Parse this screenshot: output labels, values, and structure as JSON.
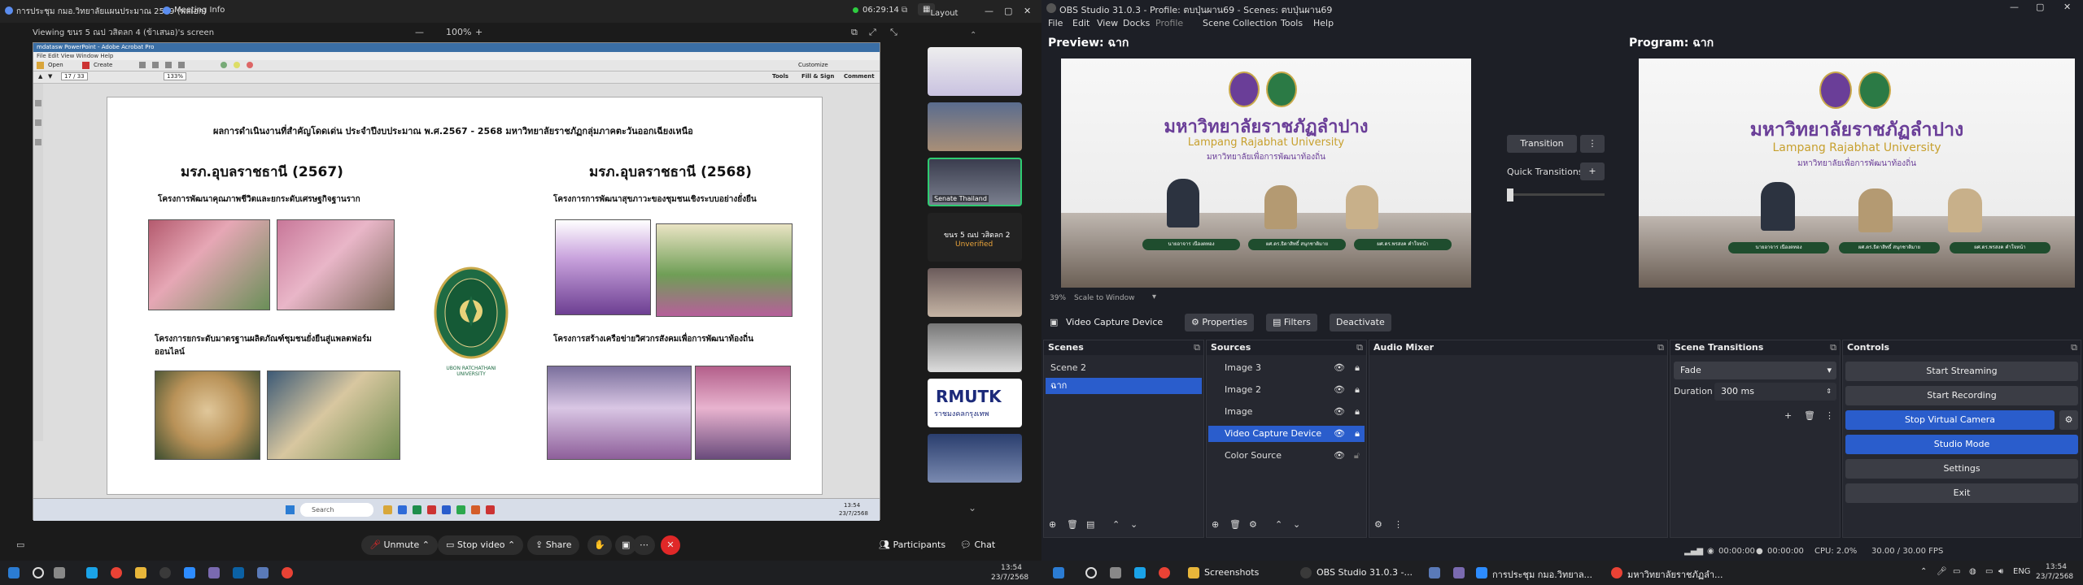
{
  "zoom": {
    "top": {
      "meeting_title": "การประชุม กมอ.วิทยาลัยแผนประมาณ 2569 (พลเอก)",
      "meeting_info": "Meeting Info",
      "timer": "06:29:14",
      "layout": "Layout"
    },
    "viewing": {
      "label": "Viewing ขนร 5 ณป วสิตลก 4 (ข้าเสนอ)'s screen",
      "zoom_level": "100%",
      "minus": "—",
      "plus": "+"
    },
    "shared_app": {
      "title": "mdatasw PowerPoint - Adobe Acrobat Pro",
      "menu": "File  Edit  View  Window  Help",
      "open": "Open",
      "create": "Create",
      "customize": "Customize",
      "page": "17 / 33",
      "zoom": "133%",
      "tools": "Tools",
      "fill_sign": "Fill & Sign",
      "comment": "Comment",
      "search": "Search",
      "clock": "13:54",
      "date": "23/7/2568"
    },
    "slide": {
      "heading": "ผลการดำเนินงานที่สำคัญโดดเด่น ประจำปีงบประมาณ พ.ศ.2567 - 2568  มหาวิทยาลัยราชภัฏกลุ่มภาคตะวันออกเฉียงเหนือ",
      "left_title": "มรภ.อุบลราชธานี (2567)",
      "right_title": "มรภ.อุบลราชธานี (2568)",
      "left_proj1": "โครงการพัฒนาคุณภาพชีวิตและยกระดับเศรษฐกิจฐานราก",
      "left_proj2": "โครงการยกระดับมาตรฐานผลิตภัณฑ์ชุมชนยั่งยืนสู่แพลตฟอร์ม",
      "left_proj2b": "ออนไลน์",
      "right_proj1": "โครงการการพัฒนาสุขภาวะของชุมชนเชิงระบบอย่างยั่งยืน",
      "right_proj2": "โครงการสร้างเครือข่ายวิศวกรสังคมเพื่อการพัฒนาท้องถิ่น",
      "logo_text": "UBON RATCHATHANI UNIVERSITY"
    },
    "participants": [
      {
        "name": ""
      },
      {
        "name": ""
      },
      {
        "name": "Senate Thailand"
      },
      {
        "name": "ขนร 5 ณป วสิตลก 2",
        "status": "Unverified"
      },
      {
        "name": ""
      },
      {
        "name": ""
      },
      {
        "name": "RMUTK",
        "sub": "ราชมงคลกรุงเทพ"
      },
      {
        "name": ""
      }
    ],
    "controls": {
      "unmute": "Unmute",
      "stop_video": "Stop video",
      "share": "Share",
      "participants": "Participants",
      "chat": "Chat"
    }
  },
  "obs": {
    "title": "OBS Studio 31.0.3 - Profile: ตบปุ่นผาน69 - Scenes: ตบปุ่นผาน69",
    "menu": [
      "File",
      "Edit",
      "View",
      "Docks",
      "Profile",
      "Scene Collection",
      "Tools",
      "Help"
    ],
    "preview_label": "Preview: ฉาก",
    "program_label": "Program: ฉาก",
    "video": {
      "university_th": "มหาวิทยาลัยราชภัฏลำปาง",
      "university_en": "Lampang Rajabhat University",
      "motto": "มหาวิทยาลัยเพื่อการพัฒนาท้องถิ่น",
      "name1": "นายอาจาร เนืองตทอง",
      "name2": "ผศ.ดร.ธิดาสิทธิ์ สนุกชาติมาย",
      "name3": "ผศ.ดร.พรสงค คำใจหน้า"
    },
    "preview_zoom": "39%",
    "scale_mode": "Scale to Window",
    "transition_btn": "Transition",
    "quick_transitions": "Quick Transitions",
    "source_bar": {
      "source": "Video Capture Device",
      "properties": "Properties",
      "filters": "Filters",
      "deactivate": "Deactivate"
    },
    "scenes": {
      "header": "Scenes",
      "items": [
        "Scene 2",
        "ฉาก"
      ]
    },
    "sources": {
      "header": "Sources",
      "items": [
        "Image 3",
        "Image 2",
        "Image",
        "Video Capture Device",
        "Color Source"
      ]
    },
    "audio_mixer": {
      "header": "Audio Mixer"
    },
    "scene_transitions": {
      "header": "Scene Transitions",
      "type": "Fade",
      "duration_label": "Duration",
      "duration": "300 ms"
    },
    "controls": {
      "header": "Controls",
      "buttons": [
        "Start Streaming",
        "Start Recording",
        "Stop Virtual Camera",
        "Studio Mode",
        "Settings",
        "Exit"
      ]
    },
    "status": {
      "rec_time": "00:00:00",
      "stream_time": "00:00:00",
      "cpu": "CPU: 2.0%",
      "fps": "30.00 / 30.00 FPS"
    }
  },
  "taskbar_right": {
    "items": [
      "Screenshots",
      "OBS Studio 31.0.3 -...",
      "การประชุม กมอ.วิทยาล...",
      "มหาวิทยาลัยราชภัฏลำ..."
    ],
    "lang": "ENG",
    "time": "13:54",
    "date": "23/7/2568"
  },
  "taskbar_left": {
    "time": "13:54",
    "date": "23/7/2568"
  },
  "colors": {
    "obs_blue": "#2a5dcc",
    "zoom_red": "#e02828"
  }
}
